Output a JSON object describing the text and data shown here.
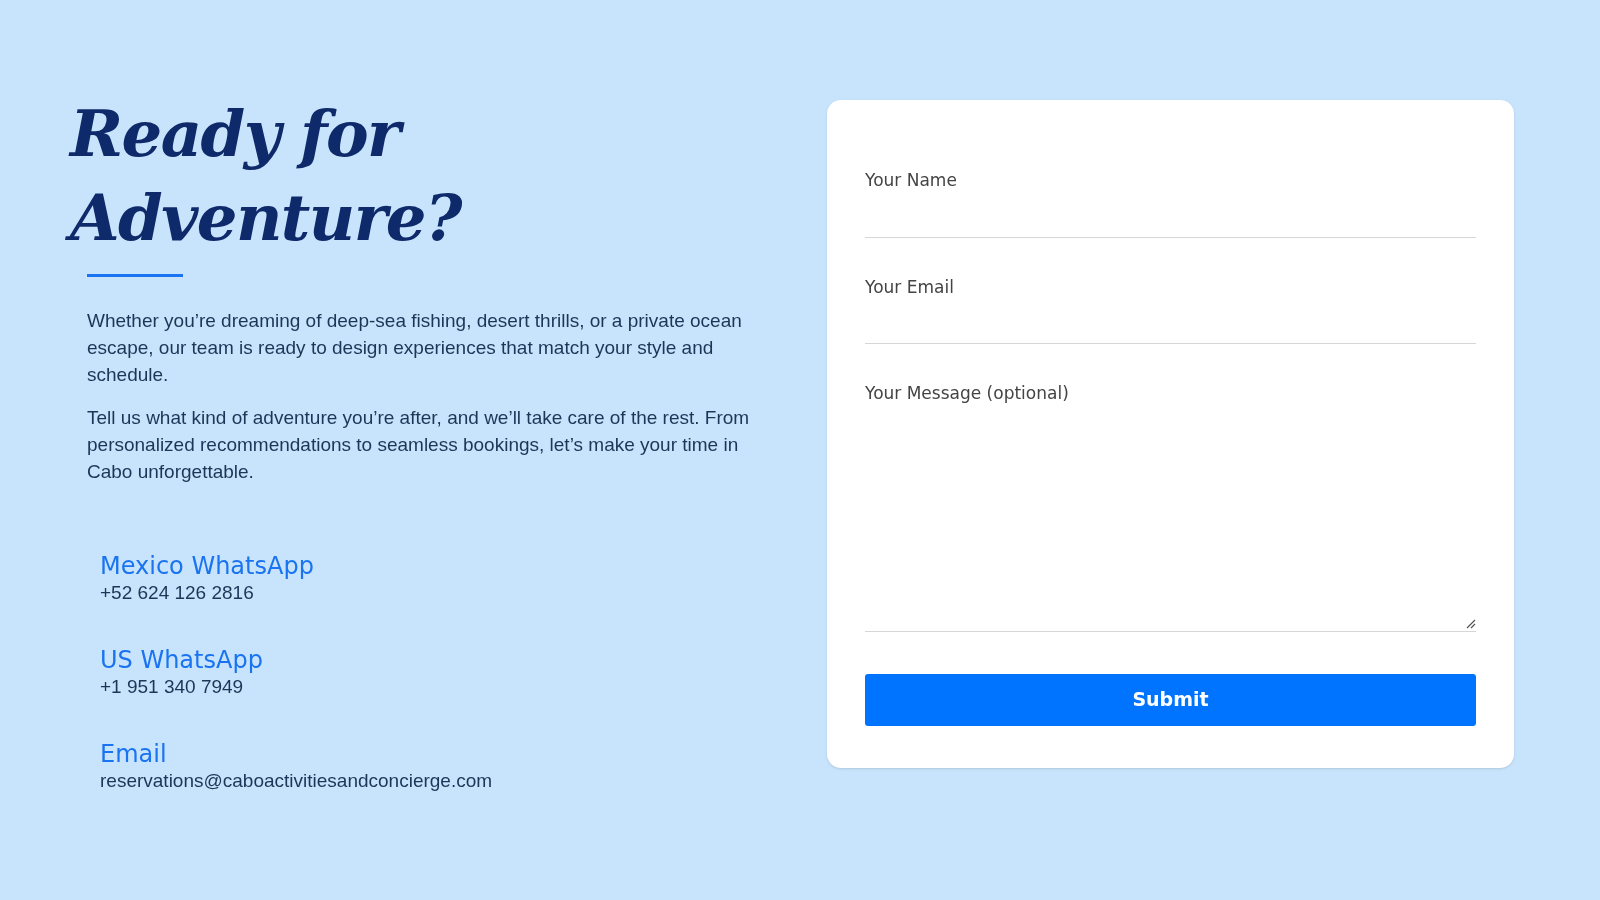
{
  "heading": "Ready for Adventure?",
  "paragraphs": [
    "Whether you’re dreaming of deep-sea fishing, desert thrills, or a private ocean escape, our team is ready to design experiences that match your style and schedule.",
    "Tell us what kind of adventure you’re after, and we’ll take care of the rest. From personalized recommendations to seamless bookings, let’s make your time in Cabo unforgettable."
  ],
  "contacts": [
    {
      "title": "Mexico WhatsApp",
      "value": "+52 624 126 2816"
    },
    {
      "title": "US WhatsApp",
      "value": "+1 951 340 7949"
    },
    {
      "title": "Email",
      "value": "reservations@caboactivitiesandconcierge.com"
    }
  ],
  "form": {
    "fields": [
      {
        "kind": "input",
        "label": "Your Name"
      },
      {
        "kind": "input",
        "label": "Your Email"
      },
      {
        "kind": "textarea",
        "label": "Your Message (optional)"
      }
    ],
    "submit": "Submit"
  }
}
